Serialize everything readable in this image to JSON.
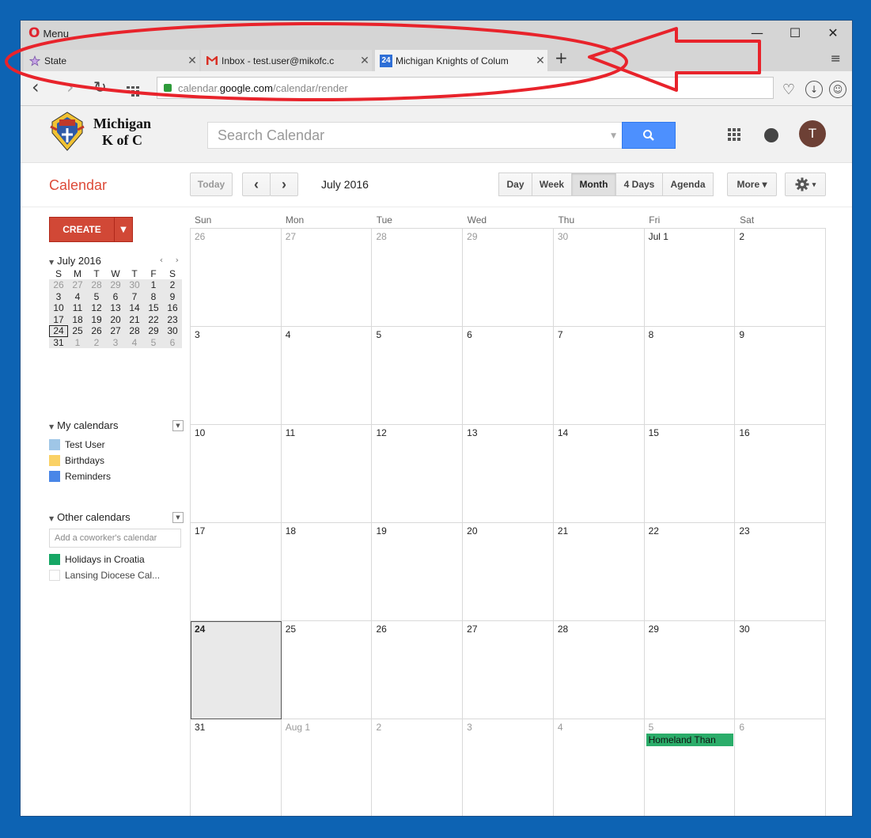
{
  "browser": {
    "menu_label": "Menu",
    "tabs": [
      {
        "title": "State",
        "icon": "star-icon"
      },
      {
        "title": "Inbox - test.user@mikofc.c",
        "icon": "gmail-icon"
      },
      {
        "title": "Michigan Knights of Colum",
        "icon": "calendar-24-icon",
        "badge": "24"
      }
    ],
    "tab_close": "✕",
    "new_tab": "+",
    "window_controls": {
      "minimize": "—",
      "maximize": "☐",
      "close": "✕"
    },
    "url": {
      "prefix": "calendar.",
      "host": "google.com",
      "path": "/calendar/render"
    }
  },
  "header": {
    "logo_line1": "Michigan",
    "logo_line2": "K of C",
    "search_placeholder": "Search Calendar",
    "avatar_letter": "T"
  },
  "toolbar": {
    "brand": "Calendar",
    "today": "Today",
    "prev": "‹",
    "next": "›",
    "month_label": "July 2016",
    "views": [
      "Day",
      "Week",
      "Month",
      "4 Days",
      "Agenda"
    ],
    "active_view": "Month",
    "more": "More ▾",
    "settings_caret": "▾"
  },
  "sidebar": {
    "create": "CREATE",
    "create_caret": "▼",
    "mini_month": "July 2016",
    "mini_nav": "‹ ›",
    "mini_dow": [
      "S",
      "M",
      "T",
      "W",
      "T",
      "F",
      "S"
    ],
    "mini_weeks": [
      [
        "26",
        "27",
        "28",
        "29",
        "30",
        "1",
        "2"
      ],
      [
        "3",
        "4",
        "5",
        "6",
        "7",
        "8",
        "9"
      ],
      [
        "10",
        "11",
        "12",
        "13",
        "14",
        "15",
        "16"
      ],
      [
        "17",
        "18",
        "19",
        "20",
        "21",
        "22",
        "23"
      ],
      [
        "24",
        "25",
        "26",
        "27",
        "28",
        "29",
        "30"
      ],
      [
        "31",
        "1",
        "2",
        "3",
        "4",
        "5",
        "6"
      ]
    ],
    "my_calendars_label": "My calendars",
    "my_calendars": [
      {
        "name": "Test User",
        "color": "#9fc6e7"
      },
      {
        "name": "Birthdays",
        "color": "#fad165"
      },
      {
        "name": "Reminders",
        "color": "#4986e7"
      }
    ],
    "other_calendars_label": "Other calendars",
    "add_coworker_placeholder": "Add a coworker's calendar",
    "other_calendars": [
      {
        "name": "Holidays in Croatia",
        "color": "#16a765"
      },
      {
        "name": "Lansing Diocese Cal...",
        "color": "#ffffff"
      }
    ]
  },
  "calendar": {
    "dow": [
      "Sun",
      "Mon",
      "Tue",
      "Wed",
      "Thu",
      "Fri",
      "Sat"
    ],
    "weeks": [
      [
        "26",
        "27",
        "28",
        "29",
        "30",
        "Jul 1",
        "2"
      ],
      [
        "3",
        "4",
        "5",
        "6",
        "7",
        "8",
        "9"
      ],
      [
        "10",
        "11",
        "12",
        "13",
        "14",
        "15",
        "16"
      ],
      [
        "17",
        "18",
        "19",
        "20",
        "21",
        "22",
        "23"
      ],
      [
        "24",
        "25",
        "26",
        "27",
        "28",
        "29",
        "30"
      ],
      [
        "31",
        "Aug 1",
        "2",
        "3",
        "4",
        "5",
        "6"
      ]
    ],
    "event": {
      "title": "Homeland Than",
      "color": "#2bad6a"
    }
  }
}
